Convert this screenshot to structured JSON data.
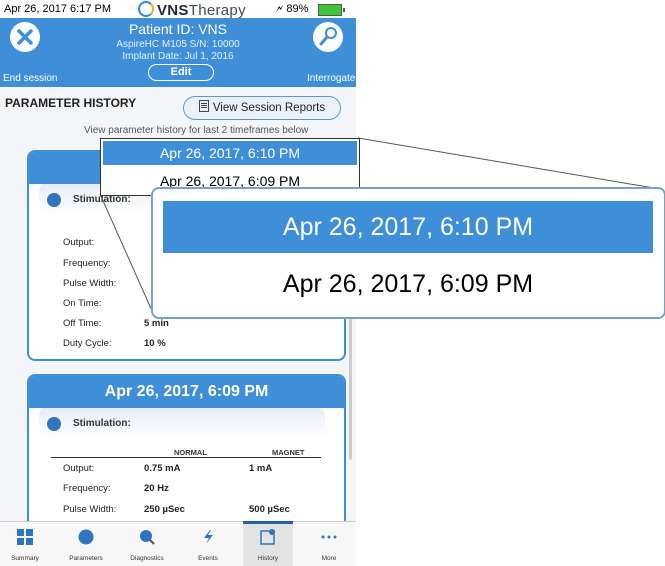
{
  "status_bar": {
    "time": "Apr 26, 2017  6:17 PM",
    "brand_bold": "VNS",
    "brand_thin": "Therapy",
    "battery": "89%"
  },
  "header": {
    "patient_id": "Patient ID: VNS",
    "model": "AspireHC M105 S/N: 10000",
    "implant_date": "Implant Date: Jul 1, 2016",
    "edit_label": "Edit",
    "end_session_label": "End session",
    "interrogate_label": "Interrogate"
  },
  "page": {
    "title": "PARAMETER HISTORY",
    "view_reports_label": "View Session Reports",
    "description": "View parameter history for last 2 timeframes below"
  },
  "card1": {
    "title": "Apr 26, 2017, 6:10 PM",
    "section_label": "Stimulation:",
    "rows": [
      {
        "label": "Output:",
        "normal": "",
        "magnet": ""
      },
      {
        "label": "Frequency:",
        "normal": "",
        "magnet": ""
      },
      {
        "label": "Pulse Width:",
        "normal": "",
        "magnet": ""
      },
      {
        "label": "On Time:",
        "normal": "",
        "magnet": ""
      },
      {
        "label": "Off Time:",
        "normal": "5 min",
        "magnet": ""
      },
      {
        "label": "Duty Cycle:",
        "normal": "10 %",
        "magnet": ""
      }
    ]
  },
  "card2": {
    "title": "Apr 26, 2017, 6:09 PM",
    "section_label": "Stimulation:",
    "col_normal": "NORMAL",
    "col_magnet": "MAGNET",
    "rows": [
      {
        "label": "Output:",
        "normal": "0.75 mA",
        "magnet": "1 mA"
      },
      {
        "label": "Frequency:",
        "normal": "20 Hz",
        "magnet": ""
      },
      {
        "label": "Pulse Width:",
        "normal": "250 µSec",
        "magnet": "500 µSec"
      }
    ]
  },
  "dropdown": {
    "selected": "Apr 26, 2017, 6:10 PM",
    "option": "Apr 26, 2017, 6:09 PM"
  },
  "tabs": [
    {
      "label": "Summary",
      "icon": "summary-icon"
    },
    {
      "label": "Parameters",
      "icon": "parameters-icon"
    },
    {
      "label": "Diagnostics",
      "icon": "diagnostics-icon"
    },
    {
      "label": "Events",
      "icon": "events-icon"
    },
    {
      "label": "History",
      "icon": "history-icon",
      "active": true
    },
    {
      "label": "More",
      "icon": "more-icon"
    }
  ],
  "colors": {
    "accent": "#3f8fd8",
    "tab_active": "#1f5fa8",
    "battery": "#3ec63a"
  }
}
